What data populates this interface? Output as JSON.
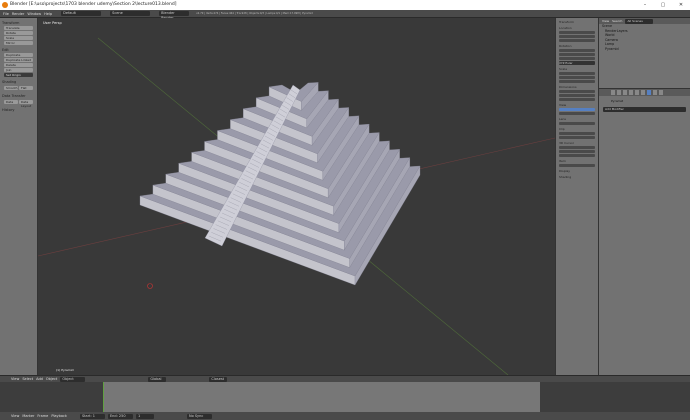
{
  "window": {
    "title": "Blender [E:\\uso\\projects\\1703 blender udemy\\Section 2\\lecture013.blend]",
    "minimize": "–",
    "maximize": "▢",
    "close": "✕"
  },
  "menu": {
    "items": [
      "File",
      "Render",
      "Window",
      "Help"
    ],
    "layout": "Default",
    "scene": "Scene",
    "engine": "Blender Render",
    "stats": "v2.79 | Verts:474 | Faces:464 | Tris:928 | Objects:0/3 | Lamps:0/1 | Mem:17.99M | Pyramid"
  },
  "toolshelf": {
    "transform_header": "Transform",
    "transform": [
      "Translate",
      "Rotate",
      "Scale",
      "Mirror"
    ],
    "edit_header": "Edit",
    "edit": [
      "Duplicate",
      "Duplicate Linked",
      "Delete",
      "Join",
      "Set Origin"
    ],
    "shading_header": "Shading",
    "shading": [
      "Smooth",
      "Flat"
    ],
    "data_header": "Data Transfer",
    "data": [
      "Data",
      "Data Layout"
    ],
    "history": "History"
  },
  "viewport": {
    "label": "User Persp",
    "object_label": "(1) Pyramid"
  },
  "npanel": {
    "transform": "Transform",
    "location": "Location",
    "rotation": "Rotation",
    "rotation_mode": "XYZ Euler",
    "scale": "Scale",
    "dimensions": "Dimensions",
    "view": "View",
    "lens": "Lens",
    "clip": "Clip",
    "cursor": "3D Cursor",
    "item": "Item",
    "display": "Display",
    "shading": "Shading"
  },
  "outliner": {
    "view": "View",
    "search": "Search",
    "scenes": "All Scenes",
    "items": [
      "Scene",
      "RenderLayers",
      "World",
      "Camera",
      "Lamp",
      "Pyramid"
    ]
  },
  "properties": {
    "object": "Pyramid",
    "add_modifier": "Add Modifier"
  },
  "header3d": {
    "items": [
      "View",
      "Select",
      "Add",
      "Object"
    ],
    "mode": "Object Mode",
    "pivot": "Global",
    "orientation": "Closest"
  },
  "timeline": {
    "items": [
      "View",
      "Marker",
      "Frame",
      "Playback"
    ],
    "start": "Start: 1",
    "end": "End: 250",
    "current": "1",
    "sync": "No Sync"
  }
}
